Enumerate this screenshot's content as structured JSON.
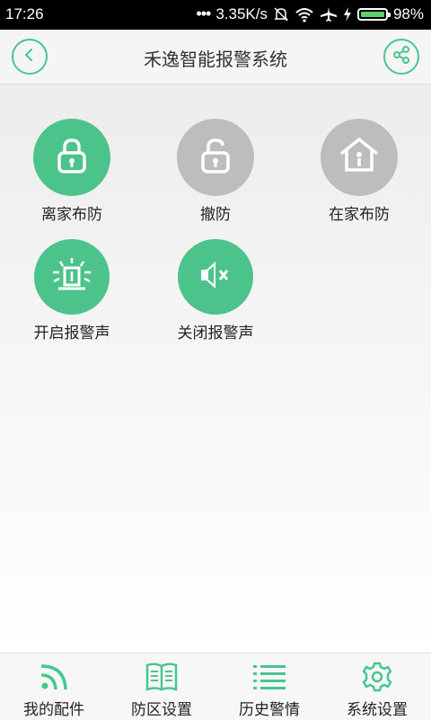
{
  "status_bar": {
    "time": "17:26",
    "network_speed": "3.35K/s",
    "battery_percent": "98%",
    "battery_level": 0.98
  },
  "header": {
    "title": "禾逸智能报警系统",
    "back_icon": "chevron-left-icon",
    "share_icon": "share-icon",
    "accent_color": "#46c78e"
  },
  "actions": [
    {
      "label": "离家布防",
      "icon": "lock-closed-icon",
      "color": "#4cc38b"
    },
    {
      "label": "撤防",
      "icon": "lock-open-icon",
      "color": "#bdbdbd"
    },
    {
      "label": "在家布防",
      "icon": "house-icon",
      "color": "#bdbdbd"
    },
    {
      "label": "开启报警声",
      "icon": "siren-icon",
      "color": "#4cc38b"
    },
    {
      "label": "关闭报警声",
      "icon": "speaker-mute-icon",
      "color": "#4cc38b"
    }
  ],
  "tabs": [
    {
      "label": "我的配件",
      "icon": "rss-icon"
    },
    {
      "label": "防区设置",
      "icon": "book-icon"
    },
    {
      "label": "历史警情",
      "icon": "list-icon"
    },
    {
      "label": "系统设置",
      "icon": "gear-icon"
    }
  ]
}
